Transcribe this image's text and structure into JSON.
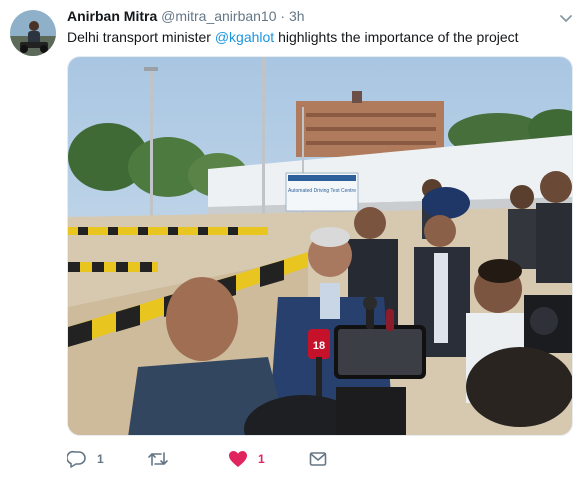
{
  "tweet": {
    "author_name": "Anirban Mitra",
    "handle": "@mitra_anirban10",
    "separator": "·",
    "time": "3h",
    "text_before": "Delhi transport minister ",
    "mention": "@kgahlot",
    "text_after": " highlights the importance of the project",
    "photo_sign_text": "Automated Driving Test Centre"
  },
  "actions": {
    "reply_count": "1",
    "retweet_count": "",
    "like_count": "1",
    "like_color": "#e0245e"
  },
  "icons": {
    "reply": "reply-icon",
    "retweet": "retweet-icon",
    "like": "heart-icon",
    "dm": "envelope-icon",
    "caret": "chevron-down-icon"
  },
  "colors": {
    "link": "#1b95e0",
    "secondary": "#657786",
    "text": "#14171a"
  }
}
